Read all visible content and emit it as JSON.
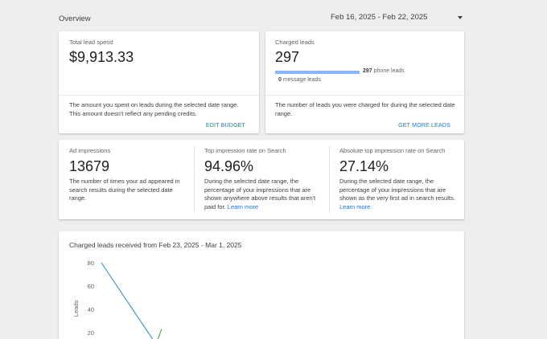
{
  "header": {
    "title": "Overview",
    "date_range": "Feb 16, 2025 - Feb 22, 2025"
  },
  "spend_card": {
    "label": "Total lead spend",
    "value": "$9,913.33",
    "description": "The amount you spent on leads during the selected date range. This amount doesn't reflect any pending credits.",
    "action": "EDIT BUDGET"
  },
  "leads_card": {
    "label": "Charged leads",
    "value": "297",
    "phone_count": "297",
    "phone_label": "phone leads",
    "message_count": "0",
    "message_label": "message leads",
    "phone_share": 1.0,
    "description": "The number of leads you were charged for during the selected date range.",
    "action": "GET MORE LEADS"
  },
  "impressions": {
    "ad": {
      "label": "Ad impressions",
      "value": "13679",
      "description": "The number of times your ad appeared in search results during the selected date range."
    },
    "top": {
      "label": "Top impression rate on Search",
      "value": "94.96%",
      "description": "During the selected date range, the percentage of your impressions that are shown anywhere above results that aren't paid for.",
      "link": "Learn more"
    },
    "abs_top": {
      "label": "Absolute top impression rate on Search",
      "value": "27.14%",
      "description": "During the selected date range, the percentage of your impressions that are shown as the very first ad in search results.",
      "link": "Learn more"
    }
  },
  "chart_card": {
    "title": "Charged leads received from Feb 23, 2025 - Mar 1, 2025"
  },
  "chart_data": {
    "type": "line",
    "title": "Charged leads received from Feb 23, 2025 - Mar 1, 2025",
    "ylabel": "Leads",
    "xlabel": "",
    "yticks": [
      80,
      60,
      40,
      20
    ],
    "series": [
      {
        "values": [
          {
            "x": 0,
            "y": 80
          },
          {
            "x": 1,
            "y": 10
          }
        ],
        "color": "#1e88c8"
      },
      {
        "values": [
          {
            "x": 1,
            "y": 10
          },
          {
            "x": 1.1,
            "y": 23
          }
        ],
        "color": "#3a9a3a"
      }
    ],
    "colors": {
      "line": "#1e88c8"
    }
  }
}
